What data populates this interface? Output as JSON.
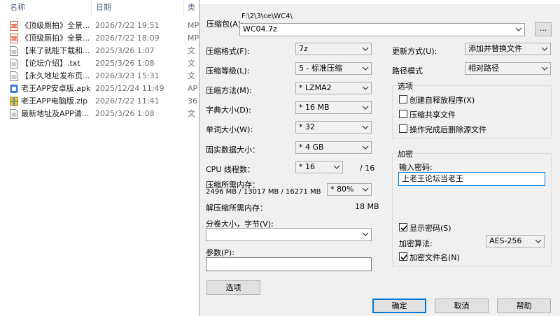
{
  "explorer": {
    "headers": {
      "name": "名称",
      "date": "日期",
      "type": "类"
    },
    "files": [
      {
        "name": "《顶级厕拍》全景...",
        "date": "2026/7/22 19:51",
        "type": "MP",
        "icon": "video-file-icon"
      },
      {
        "name": "《顶级厕拍》全景...",
        "date": "2026/7/22 18:09",
        "type": "MP",
        "icon": "video-file-icon"
      },
      {
        "name": "【来了就能下载和...",
        "date": "2025/3/26 1:07",
        "type": "文",
        "icon": "text-file-icon"
      },
      {
        "name": "【论坛介绍】.txt",
        "date": "2025/3/26 1:08",
        "type": "文",
        "icon": "text-file-icon"
      },
      {
        "name": "【永久地址发布页...",
        "date": "2026/3/23 15:31",
        "type": "文",
        "icon": "text-file-icon"
      },
      {
        "name": "老王APP安卓版.apk",
        "date": "2025/12/24 11:49",
        "type": "AP",
        "icon": "apk-file-icon"
      },
      {
        "name": "老王APP电脑版.zip",
        "date": "2026/7/22 11:41",
        "type": "36",
        "icon": "zip-file-icon"
      },
      {
        "name": "最新地址及APP请...",
        "date": "2025/3/26 1:08",
        "type": "文",
        "icon": "text-file-icon"
      }
    ]
  },
  "dialog": {
    "archive_label": "压缩包(A):",
    "archive_path": "F:\\2\\3\\ce\\WC4\\",
    "archive_name": "WC04.7z",
    "browse_label": "...",
    "left": {
      "format_label": "压缩格式(F):",
      "format_value": "7z",
      "level_label": "压缩等级(L):",
      "level_value": "5 - 标准压缩",
      "method_label": "压缩方法(M):",
      "method_value": "* LZMA2",
      "dict_label": "字典大小(D):",
      "dict_value": "* 16 MB",
      "word_label": "单词大小(W):",
      "word_value": "* 32",
      "solid_label": "固实数据大小：",
      "solid_value": "* 4 GB",
      "threads_label": "CPU 线程数：",
      "threads_value": "* 16",
      "threads_total": "/ 16",
      "mem_comp_label": "压缩所需内存：",
      "mem_comp_detail": "2496 MB / 13017 MB / 16271 MB",
      "mem_comp_value": "* 80%",
      "mem_decomp_label": "解压缩所需内存：",
      "mem_decomp_value": "18 MB",
      "split_label": "分卷大小，字节(V):",
      "split_value": "",
      "params_label": "参数(P):",
      "params_value": "",
      "options_button": "选项"
    },
    "right": {
      "update_label": "更新方式(U):",
      "update_value": "添加并替换文件",
      "pathmode_label": "路径模式",
      "pathmode_value": "相对路径",
      "options_group": "选项",
      "opt_sfx": "创建自释放程序(X)",
      "opt_shared": "压缩共享文件",
      "opt_delete": "操作完成后删除源文件",
      "encrypt_group": "加密",
      "password_label": "输入密码:",
      "password_value": "上老王论坛当老王",
      "show_password": "显示密码(S)",
      "algo_label": "加密算法:",
      "algo_value": "AES-256",
      "encrypt_names": "加密文件名(N)"
    },
    "buttons": {
      "ok": "确定",
      "cancel": "取消",
      "help": "帮助"
    }
  }
}
